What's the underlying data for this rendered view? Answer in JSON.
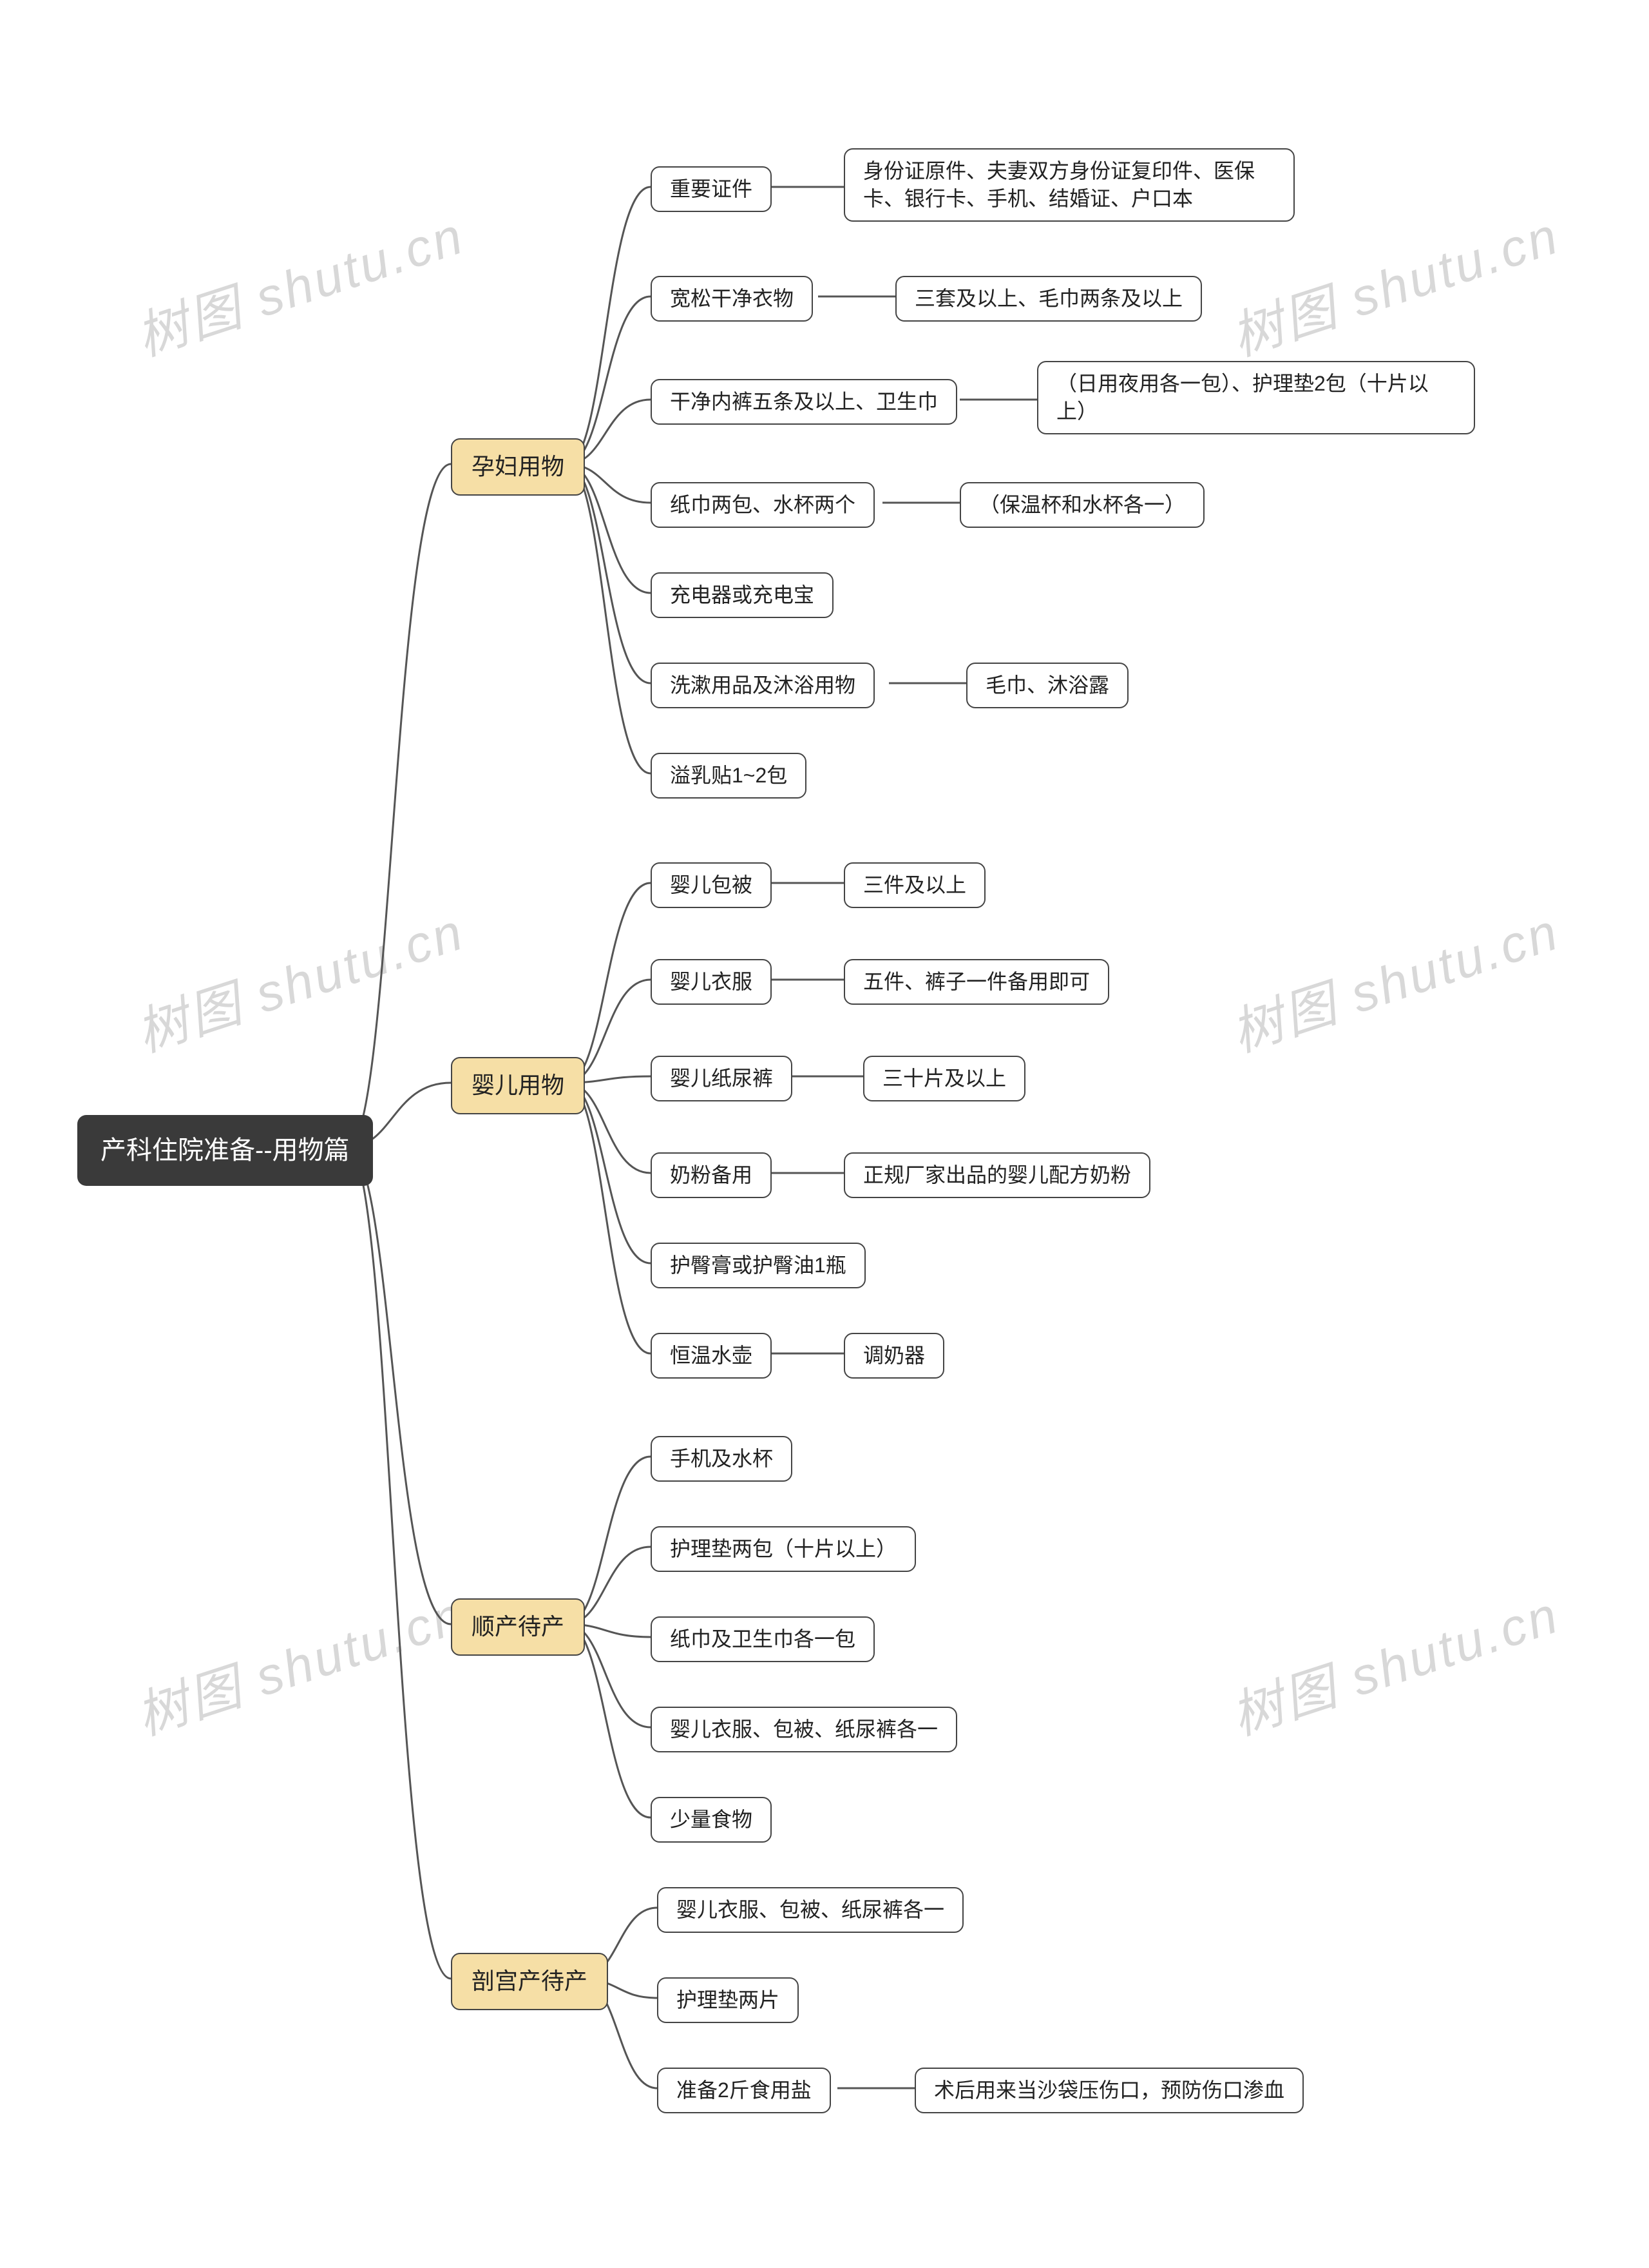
{
  "watermark": "树图 shutu.cn",
  "root": "产科住院准备--用物篇",
  "cats": {
    "c1": "孕妇用物",
    "c2": "婴儿用物",
    "c3": "顺产待产",
    "c4": "剖宫产待产"
  },
  "c1": {
    "n1": "重要证件",
    "n1d": "身份证原件、夫妻双方身份证复印件、医保卡、银行卡、手机、结婚证、户口本",
    "n2": "宽松干净衣物",
    "n2d": "三套及以上、毛巾两条及以上",
    "n3": "干净内裤五条及以上、卫生巾",
    "n3d": "（日用夜用各一包）、护理垫2包（十片以上）",
    "n4": "纸巾两包、水杯两个",
    "n4d": "（保温杯和水杯各一）",
    "n5": "充电器或充电宝",
    "n6": "洗漱用品及沐浴用物",
    "n6d": "毛巾、沐浴露",
    "n7": "溢乳贴1~2包"
  },
  "c2": {
    "n1": "婴儿包被",
    "n1d": "三件及以上",
    "n2": "婴儿衣服",
    "n2d": "五件、裤子一件备用即可",
    "n3": "婴儿纸尿裤",
    "n3d": "三十片及以上",
    "n4": "奶粉备用",
    "n4d": "正规厂家出品的婴儿配方奶粉",
    "n5": "护臀膏或护臀油1瓶",
    "n6": "恒温水壶",
    "n6d": "调奶器"
  },
  "c3": {
    "n1": "手机及水杯",
    "n2": "护理垫两包（十片以上）",
    "n3": "纸巾及卫生巾各一包",
    "n4": "婴儿衣服、包被、纸尿裤各一",
    "n5": "少量食物"
  },
  "c4": {
    "n1": "婴儿衣服、包被、纸尿裤各一",
    "n2": "护理垫两片",
    "n3": "准备2斤食用盐",
    "n3d": "术后用来当沙袋压伤口，预防伤口渗血"
  }
}
